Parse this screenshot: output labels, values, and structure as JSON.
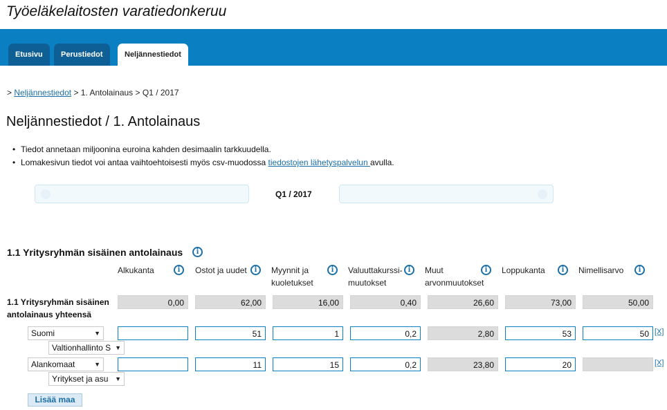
{
  "app_title": "Työeläkelaitosten varatiedonkeruu",
  "tabs": [
    {
      "label": "Etusivu",
      "active": false
    },
    {
      "label": "Perustiedot",
      "active": false
    },
    {
      "label": "Neljännestiedot",
      "active": true
    }
  ],
  "breadcrumb": {
    "prefix": ">",
    "link": "Neljännestiedot",
    "rest": "> 1. Antolainaus > Q1 / 2017"
  },
  "page_title": "Neljännestiedot / 1. Antolainaus",
  "bullets": {
    "b1": "Tiedot annetaan miljoonina euroina kahden desimaalin tarkkuudella.",
    "b2_before": "Lomakesivun tiedot voi antaa vaihtoehtoisesti myös csv-muodossa ",
    "b2_link": "tiedostojen lähetyspalvelun ",
    "b2_after": "avulla."
  },
  "period": {
    "label": "Q1 / 2017"
  },
  "section": {
    "title": "1.1 Yritysryhmän sisäinen antolainaus"
  },
  "columns": [
    {
      "l1": "Alkukanta",
      "l2": ""
    },
    {
      "l1": "Ostot ja uudet",
      "l2": ""
    },
    {
      "l1": "Myynnit ja",
      "l2": "kuoletukset"
    },
    {
      "l1": "Valuuttakurssi-",
      "l2": "muutokset"
    },
    {
      "l1": "Muut",
      "l2": "arvonmuutokset"
    },
    {
      "l1": "Loppukanta",
      "l2": ""
    },
    {
      "l1": "Nimellisarvo",
      "l2": ""
    }
  ],
  "total_row": {
    "label_l1": "1.1 Yritysryhmän sisäinen",
    "label_l2": "antolainaus yhteensä",
    "values": [
      "0,00",
      "62,00",
      "16,00",
      "0,40",
      "26,60",
      "73,00",
      "50,00"
    ]
  },
  "rows": [
    {
      "country": "Suomi",
      "sector": "Valtionhallinto S",
      "values": [
        "",
        "51",
        "1",
        "0,2",
        "2,80",
        "53",
        "50"
      ],
      "remove": "[X]"
    },
    {
      "country": "Alankomaat",
      "sector": "Yritykset ja asu",
      "values": [
        "",
        "11",
        "15",
        "0,2",
        "23,80",
        "20",
        ""
      ],
      "remove": "[X]"
    }
  ],
  "add_button": "Lisää maa",
  "icons": {
    "info": "info-icon",
    "dropdown": "chevron-down-icon"
  },
  "colors": {
    "nav": "#0a7fc1",
    "tab_inactive": "#0e5f95",
    "link": "#1a6fa8",
    "readonly_cell": "#dcdcdc"
  }
}
